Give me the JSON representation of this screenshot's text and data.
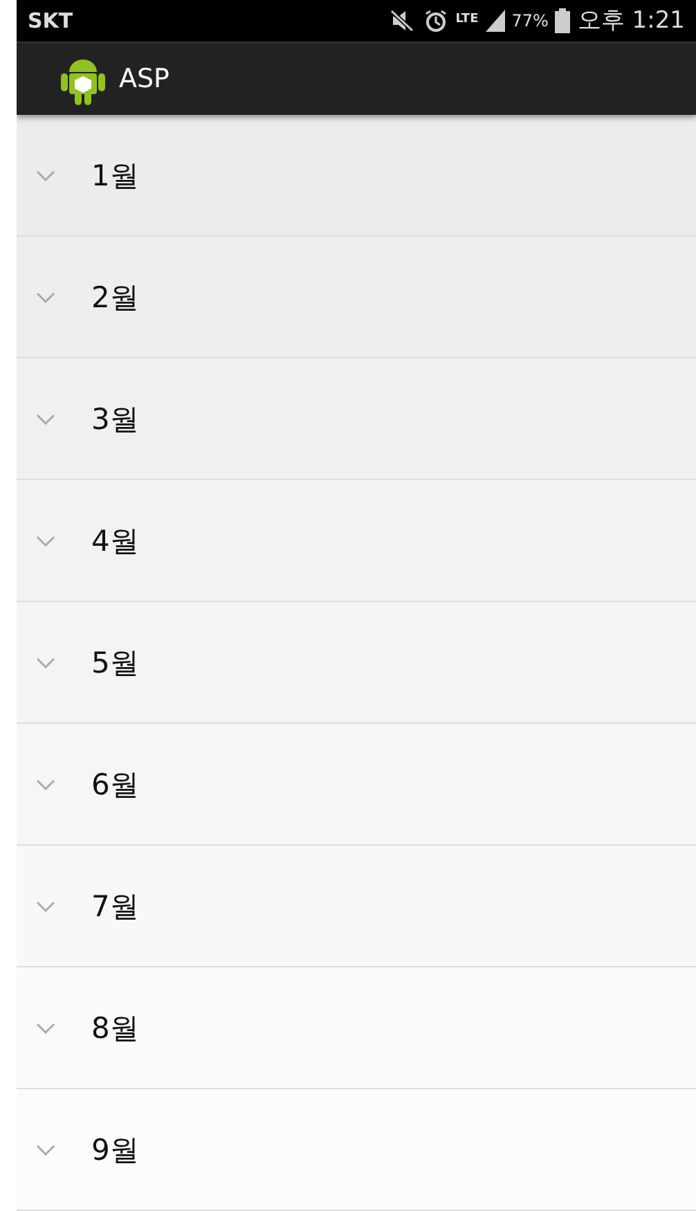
{
  "status_bar": {
    "carrier": "SKT",
    "network": "LTE",
    "battery": "77%",
    "time": "오후 1:21"
  },
  "action_bar": {
    "title": "ASP"
  },
  "groups": [
    {
      "label": "1월",
      "expanded": false
    },
    {
      "label": "2월",
      "expanded": false
    },
    {
      "label": "3월",
      "expanded": false
    },
    {
      "label": "4월",
      "expanded": false
    },
    {
      "label": "5월",
      "expanded": false
    },
    {
      "label": "6월",
      "expanded": false
    },
    {
      "label": "7월",
      "expanded": false
    },
    {
      "label": "8월",
      "expanded": false
    },
    {
      "label": "9월",
      "expanded": false
    }
  ]
}
